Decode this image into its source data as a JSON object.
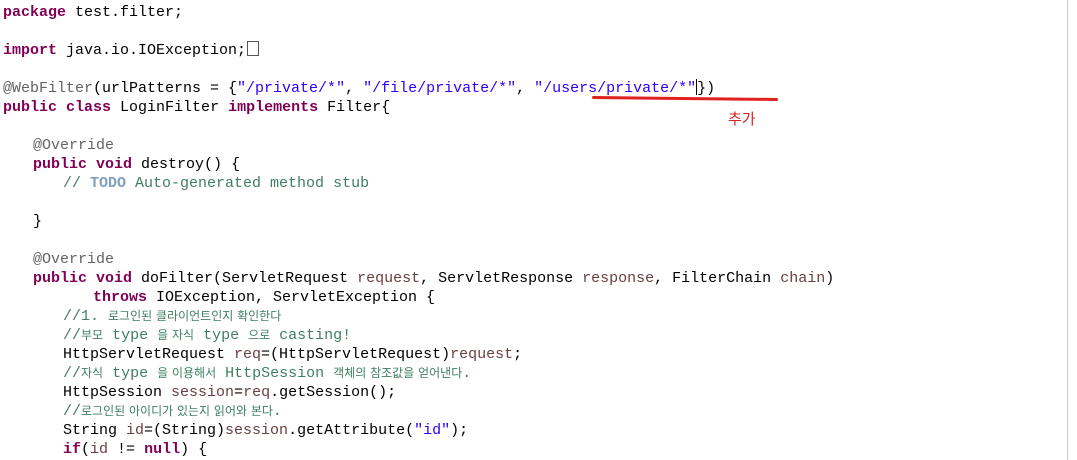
{
  "editor": {
    "lines": {
      "l1": {
        "package_kw": "package",
        "rest": " test.filter;"
      },
      "l2": {
        "import_kw": "import",
        "rest": " java.io.IOException;"
      },
      "l3": {
        "annotation": "@WebFilter",
        "a": "(urlPatterns = {",
        "s1": "\"/private/*\"",
        "c1": ", ",
        "s2": "\"/file/private/*\"",
        "c2": ", ",
        "s3": "\"/users/private/*\"",
        "end": "})"
      },
      "l4": {
        "kw1": "public",
        "kw2": "class",
        "name": " LoginFilter ",
        "kw3": "implements",
        "rest": " Filter{"
      },
      "l5": {
        "annotation": "@Override"
      },
      "l6": {
        "kw1": "public",
        "kw2": "void",
        "rest": " destroy() {"
      },
      "l7": {
        "slashes": "// ",
        "todo": "TODO",
        "rest": " Auto-generated method stub"
      },
      "l8": {
        "rest": "}"
      },
      "l9": {
        "annotation": "@Override"
      },
      "l10": {
        "kw1": "public",
        "kw2": "void",
        "a": " doFilter(ServletRequest ",
        "p1": "request",
        "b": ", ServletResponse ",
        "p2": "response",
        "c": ", FilterChain ",
        "p3": "chain",
        "end": ")"
      },
      "l11": {
        "kw": "throws",
        "rest": " IOException, ServletException {"
      },
      "l12": {
        "slashes": "//1. ",
        "kr": "로그인된 클라이언트인지 확인한다"
      },
      "l13": {
        "slashes": "//",
        "kr1": "부모",
        "t1": " type ",
        "kr2": "을 자식",
        "t2": " type ",
        "kr3": "으로",
        "t3": " casting!"
      },
      "l14": {
        "a": "HttpServletRequest ",
        "v": "req",
        "b": "=(HttpServletRequest)",
        "p": "request",
        "end": ";"
      },
      "l15": {
        "slashes": "//",
        "kr1": "자식",
        "t1": " type ",
        "kr2": "을 이용해서",
        "t2": " HttpSession ",
        "kr3": "객체의 참조값을 얻어낸다",
        "end": "."
      },
      "l16": {
        "a": "HttpSession ",
        "v": "session",
        "b": "=",
        "v2": "req",
        "end": ".getSession();"
      },
      "l17": {
        "slashes": "//",
        "kr": "로그인된 아이디가 있는지 읽어와 본다",
        "end": "."
      },
      "l18": {
        "a": "String ",
        "v": "id",
        "b": "=(String)",
        "v2": "session",
        "c": ".getAttribute(",
        "s": "\"id\"",
        "end": ");"
      },
      "l19": {
        "kw1": "if",
        "a": "(",
        "v": "id",
        "b": " != ",
        "kw2": "null",
        "end": ") {"
      }
    }
  },
  "annotation": {
    "label": "추가",
    "color": "#e02020"
  },
  "colors": {
    "keyword": "#7f0055",
    "string": "#2a00ff",
    "comment": "#3f7f5f",
    "annotation": "#646464",
    "field": "#0000c0",
    "parameter": "#6a3e3e"
  }
}
